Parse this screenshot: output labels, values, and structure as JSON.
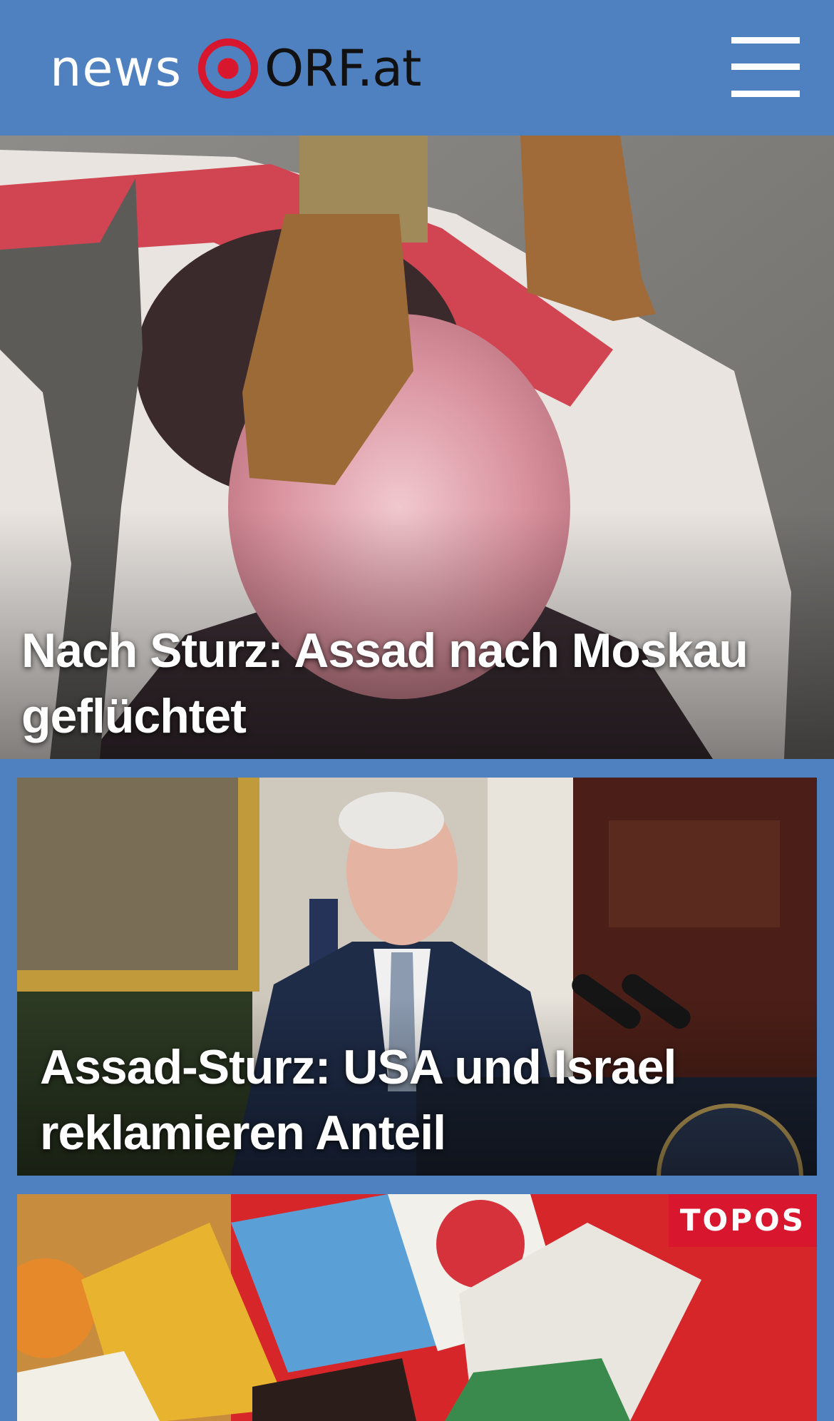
{
  "header": {
    "logo_text_news": "news",
    "logo_text_orf": "ORF.at",
    "brand_color": "#d8162d",
    "background_color": "#4f80bf"
  },
  "stories": [
    {
      "headline": "Nach Sturz: Assad nach Moskau geflüchtet"
    },
    {
      "headline": "Assad-Sturz: USA und Israel reklamieren Anteil"
    },
    {
      "badge": "TOPOS"
    }
  ]
}
